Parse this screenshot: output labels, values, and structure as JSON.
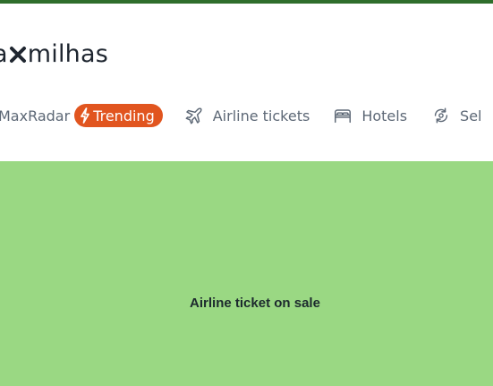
{
  "logo": {
    "prefix": "a",
    "suffix": "milhas"
  },
  "nav": {
    "items": [
      {
        "label": "MaxRadar",
        "badge": "Trending",
        "icon": "lightning-icon"
      },
      {
        "label": "Airline tickets",
        "icon": "airplane-icon"
      },
      {
        "label": "Hotels",
        "icon": "bed-icon"
      },
      {
        "label": "Sel",
        "icon": "refresh-icon"
      }
    ]
  },
  "hero": {
    "title": "Airline ticket on sale"
  },
  "colors": {
    "top_bar": "#2f6e2c",
    "badge": "#e1551f",
    "hero_background": "#9ad883",
    "nav_text": "#5d6876"
  }
}
